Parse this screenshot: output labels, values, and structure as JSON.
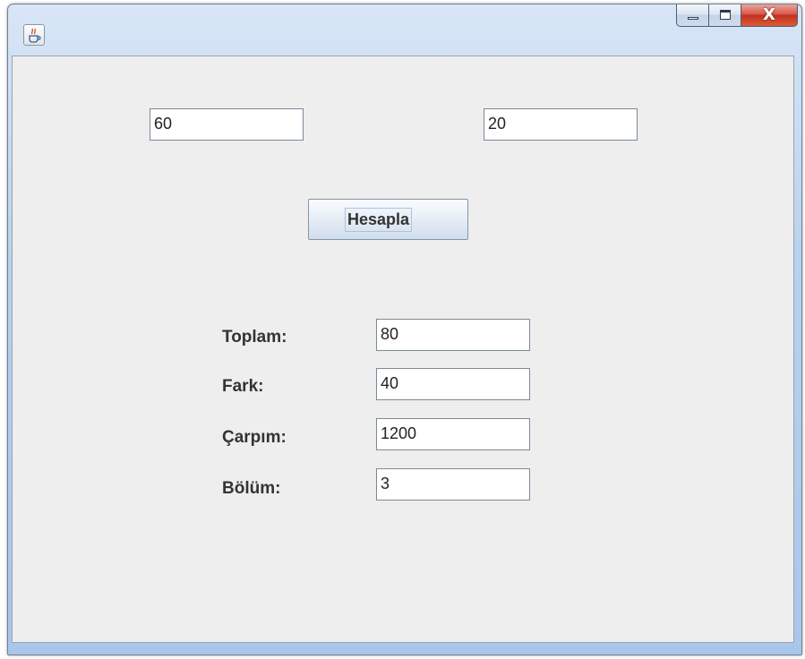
{
  "window": {
    "title": ""
  },
  "caption_buttons": {
    "close_glyph": "X"
  },
  "inputs": {
    "first": "60",
    "second": "20"
  },
  "calculate_button": {
    "label": "Hesapla"
  },
  "results": [
    {
      "label": "Toplam:",
      "value": "80"
    },
    {
      "label": "Fark:",
      "value": "40"
    },
    {
      "label": "Çarpım:",
      "value": "1200"
    },
    {
      "label": "Bölüm:",
      "value": "3"
    }
  ],
  "icons": {
    "app": "java-coffee-icon",
    "minimize": "minimize-icon",
    "maximize": "maximize-icon",
    "close": "close-icon"
  }
}
